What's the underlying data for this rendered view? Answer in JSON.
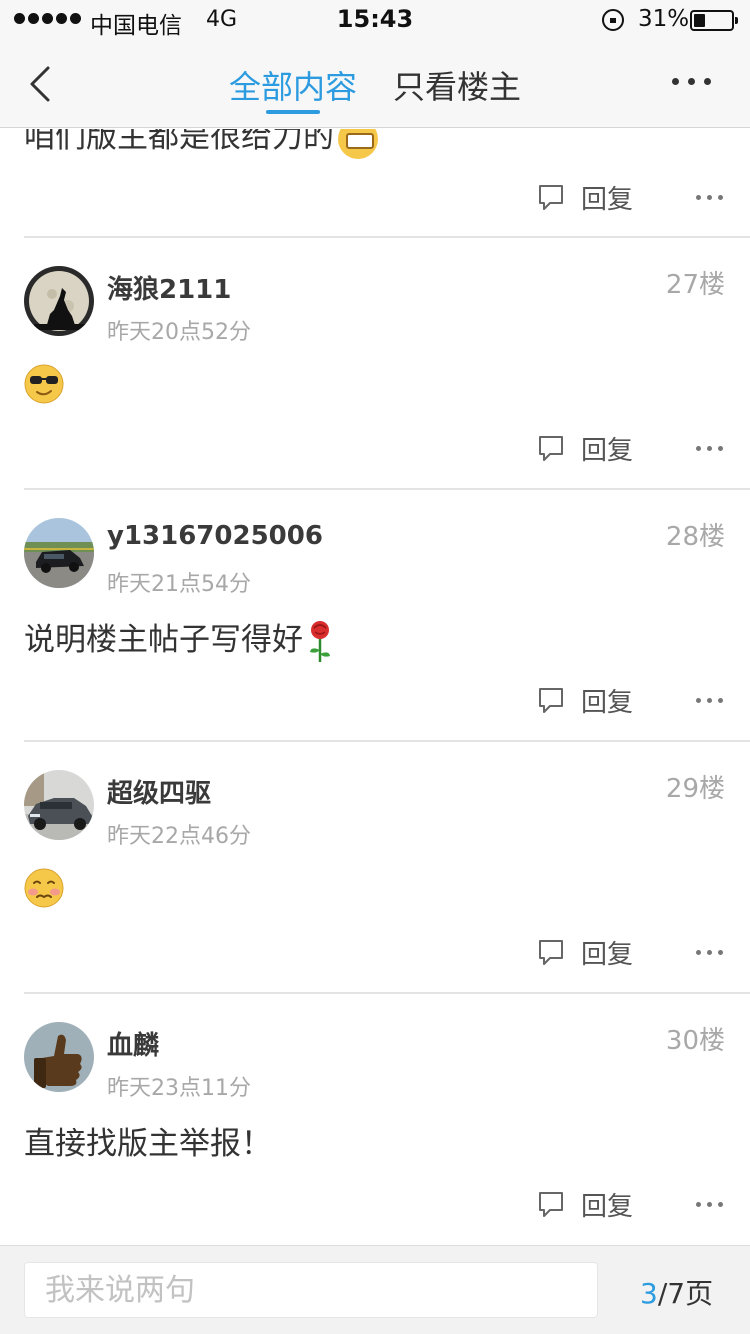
{
  "status_bar": {
    "carrier": "中国电信",
    "network": "4G",
    "time": "15:43",
    "battery_percent_text": "31%",
    "battery_level": 0.31
  },
  "nav": {
    "back_icon": "chevron-left-icon",
    "tabs": [
      {
        "label": "全部内容",
        "active": true
      },
      {
        "label": "只看楼主",
        "active": false
      }
    ],
    "more_icon": "more-horizontal-icon"
  },
  "colors": {
    "accent": "#2c9be0",
    "text": "#333333",
    "muted": "#a8a8a8"
  },
  "partial_post": {
    "text": "咱们版主都是很给力的"
  },
  "reply_label": "回复",
  "posts": [
    {
      "author": "海狼2111",
      "time": "昨天20点52分",
      "floor": "27楼",
      "text": "",
      "emoji": "sunglasses-emoji"
    },
    {
      "author": "y13167025006",
      "time": "昨天21点54分",
      "floor": "28楼",
      "text": "说明楼主帖子写得好",
      "emoji": "rose-emoji"
    },
    {
      "author": "超级四驱",
      "time": "昨天22点46分",
      "floor": "29楼",
      "text": "",
      "emoji": "shy-emoji"
    },
    {
      "author": "血麟",
      "time": "昨天23点11分",
      "floor": "30楼",
      "text": "直接找版主举报！",
      "emoji": ""
    }
  ],
  "bottom_bar": {
    "input_placeholder": "我来说两句",
    "page_current": "3",
    "page_total": "/7页"
  }
}
